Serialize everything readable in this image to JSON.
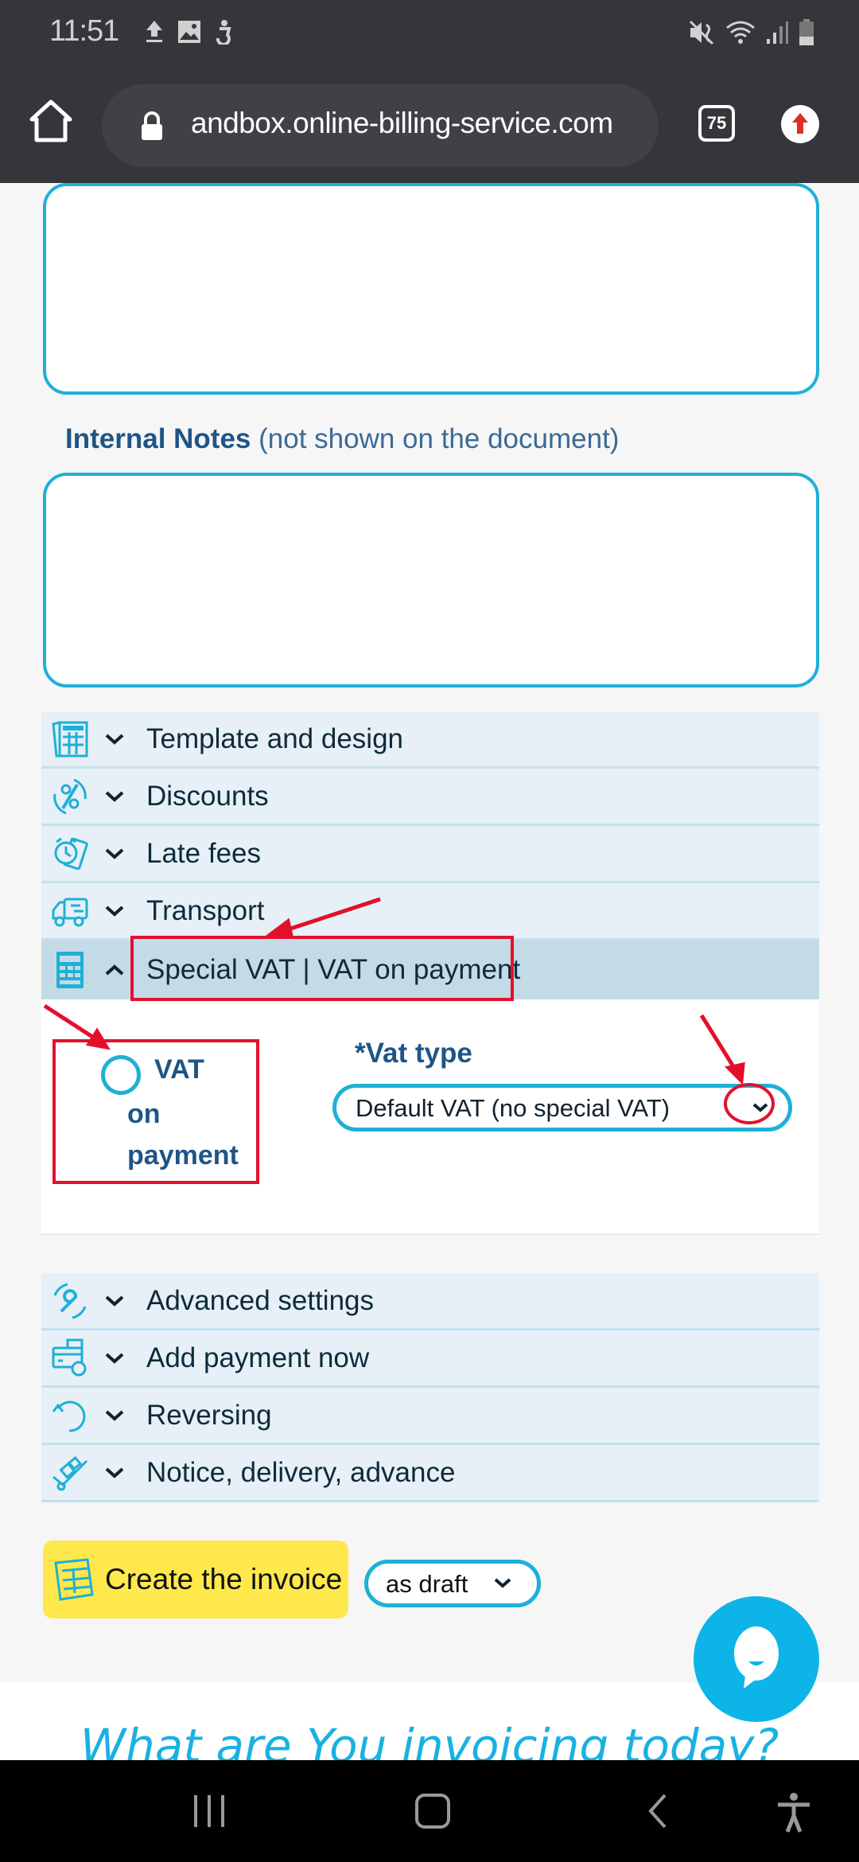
{
  "status_bar": {
    "time": "11:51",
    "left_icons": [
      "upload-icon",
      "image-icon",
      "accessibility-notification-icon"
    ],
    "right_icons": [
      "mute-icon",
      "wifi-icon",
      "signal-icon",
      "battery-icon"
    ]
  },
  "browser": {
    "url": "andbox.online-billing-service.com",
    "tab_count": "75"
  },
  "form": {
    "notes_textarea_value": "",
    "internal_notes_label": "Internal Notes",
    "internal_notes_hint": "(not shown on the document)",
    "internal_notes_value": ""
  },
  "accordion_top": [
    {
      "label": "Template and design",
      "icon": "template-icon",
      "state": "collapsed"
    },
    {
      "label": "Discounts",
      "icon": "discount-icon",
      "state": "collapsed"
    },
    {
      "label": "Late fees",
      "icon": "late-fees-icon",
      "state": "collapsed"
    },
    {
      "label": "Transport",
      "icon": "truck-icon",
      "state": "collapsed"
    },
    {
      "label": "Special VAT | VAT on payment",
      "icon": "calculator-icon",
      "state": "expanded"
    }
  ],
  "vat_panel": {
    "radio_label_line1": "VAT",
    "radio_label_line2": "on",
    "radio_label_line3": "payment",
    "radio_checked": false,
    "vat_type_required_mark": "*",
    "vat_type_label": "Vat type",
    "vat_type_value": "Default VAT (no special VAT)"
  },
  "accordion_bottom": [
    {
      "label": "Advanced settings",
      "icon": "wrench-icon",
      "state": "collapsed"
    },
    {
      "label": "Add payment now",
      "icon": "payment-icon",
      "state": "collapsed"
    },
    {
      "label": "Reversing",
      "icon": "reverse-icon",
      "state": "collapsed"
    },
    {
      "label": "Notice, delivery, advance",
      "icon": "hand-truck-icon",
      "state": "collapsed"
    }
  ],
  "actions": {
    "create_label": "Create the invoice",
    "save_mode_value": "as draft"
  },
  "footer": {
    "headline": "What are You invoicing today?"
  },
  "colors": {
    "accent": "#1fb0d6",
    "heading_blue": "#1e5586",
    "create_button": "#ffe84c",
    "annotation_red": "#e3102c",
    "accordion_bg": "#e6f0f6",
    "accordion_open_bg": "#c3dbe7"
  }
}
